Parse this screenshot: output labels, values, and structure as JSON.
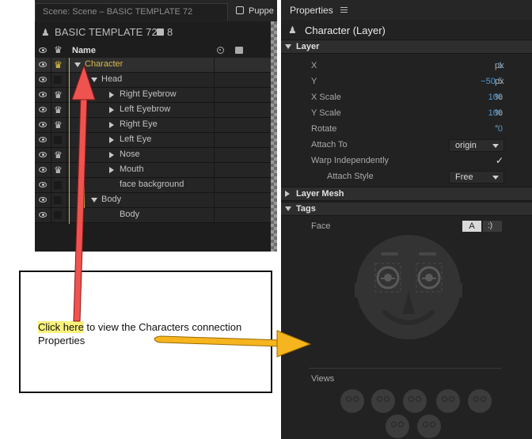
{
  "scene_panel": {
    "tab_scene": "Scene: Scene – BASIC TEMPLATE 72",
    "tab_puppet": "Puppe",
    "title": "BASIC TEMPLATE 72",
    "count": "8",
    "name_header": "Name",
    "layers": [
      {
        "label": "Character",
        "depth": 0,
        "expander": "expanded",
        "crown": true,
        "selected": true
      },
      {
        "label": "Head",
        "depth": 1,
        "expander": "expanded",
        "crown": false,
        "selected": false
      },
      {
        "label": "Right Eyebrow",
        "depth": 2,
        "expander": "collapsed",
        "crown": true,
        "selected": false
      },
      {
        "label": "Left Eyebrow",
        "depth": 2,
        "expander": "collapsed",
        "crown": true,
        "selected": false
      },
      {
        "label": "Right Eye",
        "depth": 2,
        "expander": "collapsed",
        "crown": true,
        "selected": false
      },
      {
        "label": "Left Eye",
        "depth": 2,
        "expander": "collapsed",
        "crown": false,
        "selected": false
      },
      {
        "label": "Nose",
        "depth": 2,
        "expander": "collapsed",
        "crown": true,
        "selected": false
      },
      {
        "label": "Mouth",
        "depth": 2,
        "expander": "collapsed",
        "crown": true,
        "selected": false
      },
      {
        "label": "face background",
        "depth": 2,
        "expander": "none",
        "crown": false,
        "selected": false
      },
      {
        "label": "Body",
        "depth": 1,
        "expander": "expanded",
        "crown": false,
        "selected": false
      },
      {
        "label": "Body",
        "depth": 2,
        "expander": "none",
        "crown": false,
        "selected": false
      }
    ]
  },
  "properties": {
    "panel_title": "Properties",
    "object_title": "Character (Layer)",
    "section_layer": "Layer",
    "rows": {
      "x": {
        "label": "X",
        "value": "1",
        "unit": "px"
      },
      "y": {
        "label": "Y",
        "value": "−50.5",
        "unit": "px"
      },
      "xscale": {
        "label": "X Scale",
        "value": "100",
        "unit": "%"
      },
      "yscale": {
        "label": "Y Scale",
        "value": "100",
        "unit": "%"
      },
      "rotate": {
        "label": "Rotate",
        "value": "0",
        "unit": "°"
      }
    },
    "attach_to_label": "Attach To",
    "attach_to_value": "origin",
    "warp_label": "Warp Independently",
    "warp_check": "✓",
    "attach_style_label": "Attach Style",
    "attach_style_value": "Free",
    "section_layer_mesh": "Layer Mesh",
    "section_tags": "Tags",
    "face_label": "Face",
    "face_toggle_a": "A",
    "views_label": "Views"
  },
  "callout": {
    "highlight": "Click here",
    "text": " to view the Characters connection Properties"
  },
  "colors": {
    "arrow_red": "#ef5350",
    "arrow_yellow": "#f6b51e",
    "highlight": "#fbf27b",
    "accent_blue": "#4e9ad6",
    "selected_label": "#d8b94a"
  }
}
